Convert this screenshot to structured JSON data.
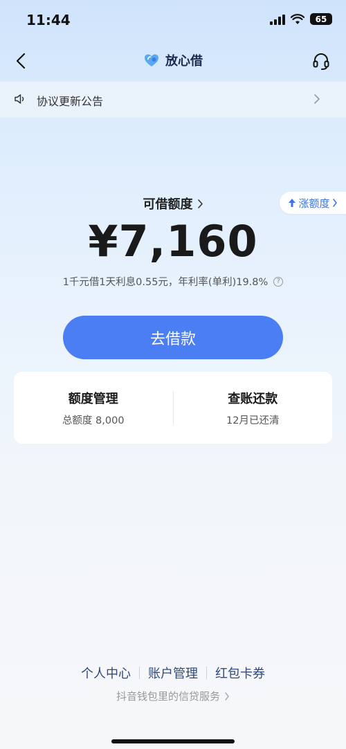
{
  "status_bar": {
    "time": "11:44",
    "battery": "65"
  },
  "nav": {
    "brand": "放心借",
    "brand_color": "#4a90e2"
  },
  "notice": {
    "text": "协议更新公告"
  },
  "raise_limit": {
    "label": "涨额度"
  },
  "credit": {
    "label": "可借额度",
    "amount": "¥7,160",
    "rate_text": "1千元借1天利息0.55元，年利率(单利)19.8%"
  },
  "borrow_button": {
    "label": "去借款",
    "color": "#4a7ef2"
  },
  "cards": [
    {
      "title": "额度管理",
      "subtitle": "总额度 8,000"
    },
    {
      "title": "查账还款",
      "subtitle": "12月已还清"
    }
  ],
  "footer": {
    "links": [
      "个人中心",
      "账户管理",
      "红包卡券"
    ],
    "service_text": "抖音钱包里的信贷服务"
  }
}
